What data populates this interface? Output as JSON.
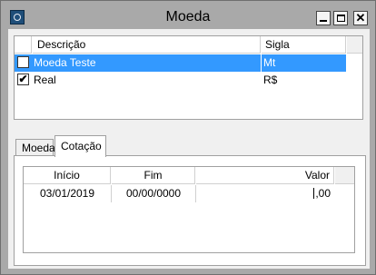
{
  "window": {
    "title": "Moeda"
  },
  "currencies": {
    "headers": {
      "descricao": "Descrição",
      "sigla": "Sigla"
    },
    "rows": [
      {
        "descricao": "Moeda Teste",
        "sigla": "Mt",
        "checked": false,
        "selected": true
      },
      {
        "descricao": "Real",
        "sigla": "R$",
        "checked": true,
        "selected": false
      }
    ]
  },
  "tabs": [
    {
      "label": "Moeda",
      "active": false
    },
    {
      "label": "Cotação",
      "active": true
    }
  ],
  "cotacao": {
    "headers": {
      "inicio": "Início",
      "fim": "Fim",
      "valor": "Valor"
    },
    "rows": [
      {
        "inicio": "03/01/2019",
        "fim": "00/00/0000",
        "valor": ",00"
      }
    ]
  },
  "colors": {
    "selection": "#3399ff",
    "titlebar": "#a9a9a9"
  }
}
